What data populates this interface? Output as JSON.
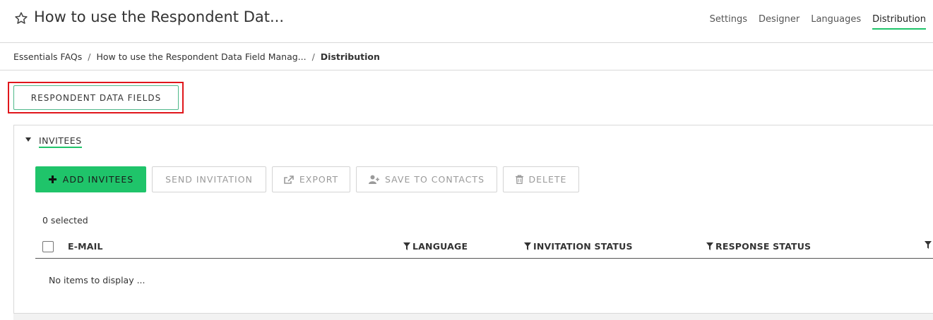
{
  "header": {
    "title": "How to use the Respondent Dat...",
    "nav": [
      {
        "label": "Settings",
        "active": false
      },
      {
        "label": "Designer",
        "active": false
      },
      {
        "label": "Languages",
        "active": false
      },
      {
        "label": "Distribution",
        "active": true
      }
    ]
  },
  "breadcrumb": {
    "items": [
      "Essentials FAQs",
      "How to use the Respondent Data Field Manag...",
      "Distribution"
    ]
  },
  "respondent_button": {
    "label": "RESPONDENT DATA FIELDS"
  },
  "invitees": {
    "title": "INVITEES",
    "actions": {
      "add": "ADD INVITEES",
      "send": "SEND INVITATION",
      "export": "EXPORT",
      "save": "SAVE TO CONTACTS",
      "delete": "DELETE"
    },
    "selected_text": "0 selected",
    "columns": {
      "email": "E-MAIL",
      "language": "LANGUAGE",
      "invitation_status": "INVITATION STATUS",
      "response_status": "RESPONSE STATUS"
    },
    "empty_text": "No items to display ..."
  },
  "colors": {
    "accent": "#1fc46a",
    "highlight": "#e0161b"
  },
  "icons": {
    "star": "star-icon",
    "collapse": "triangle-down-icon",
    "add": "plus-icon",
    "export": "export-icon",
    "save": "add-user-icon",
    "delete": "trash-icon",
    "filter": "filter-icon"
  }
}
